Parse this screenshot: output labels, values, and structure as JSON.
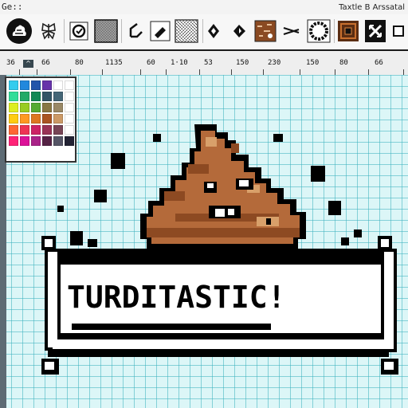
{
  "window": {
    "title_left": "Ge::",
    "title_right": "Taxtle B Arssatal"
  },
  "toolbar": {
    "tools": [
      {
        "name": "blob-tool",
        "icon": "blob-icon"
      },
      {
        "name": "symmetry-tool",
        "icon": "butterfly-icon"
      },
      {
        "name": "select-check-tool",
        "icon": "check-circle-icon"
      },
      {
        "name": "dither-pattern-tool",
        "icon": "dither-icon"
      },
      {
        "name": "line-tool",
        "icon": "diagonal-line-icon"
      },
      {
        "name": "eraser-tool",
        "icon": "eraser-icon"
      },
      {
        "name": "noise-pattern-tool",
        "icon": "noise-icon"
      },
      {
        "name": "shape-tool",
        "icon": "diamond-icon"
      },
      {
        "name": "paint-bucket-tool",
        "icon": "bucket-icon"
      },
      {
        "name": "texture-tool",
        "icon": "texture-icon"
      },
      {
        "name": "scissors-tool",
        "icon": "scissors-icon"
      },
      {
        "name": "ring-tool",
        "icon": "ring-icon"
      },
      {
        "name": "frame-tool",
        "icon": "frame-icon"
      },
      {
        "name": "move-tool",
        "icon": "arrows-icon"
      },
      {
        "name": "square-tool",
        "icon": "square-icon"
      }
    ]
  },
  "ruler": {
    "labels": [
      "36",
      "66",
      "80",
      "1135",
      "60",
      "1·10",
      "53",
      "150",
      "230",
      "150",
      "80",
      "66"
    ],
    "cursor_label": "^"
  },
  "palette": {
    "colors": [
      "#33ccee",
      "#2288dd",
      "#2255aa",
      "#6633aa",
      "#ffffff",
      "#ffffff",
      "#33dd99",
      "#22aa66",
      "#118855",
      "#335566",
      "#446677",
      "#ffffff",
      "#ddee22",
      "#99cc22",
      "#55aa33",
      "#887744",
      "#998866",
      "#ffffff",
      "#ffcc11",
      "#ff9922",
      "#dd7722",
      "#aa5522",
      "#cc9966",
      "#ffffff",
      "#ff6633",
      "#ee3355",
      "#cc2266",
      "#993355",
      "#774455",
      "#ffffff",
      "#ff2277",
      "#dd1199",
      "#aa2288",
      "#552244",
      "#555566",
      "#222233"
    ]
  },
  "artwork": {
    "banner_text": "TURDITASTIC!",
    "colors": {
      "poop_light": "#b46a3a",
      "poop_mid": "#8d4a22",
      "poop_dark": "#5b2d12",
      "outline": "#000000",
      "highlight": "#d8a06a",
      "banner_fill": "#ffffff"
    }
  }
}
